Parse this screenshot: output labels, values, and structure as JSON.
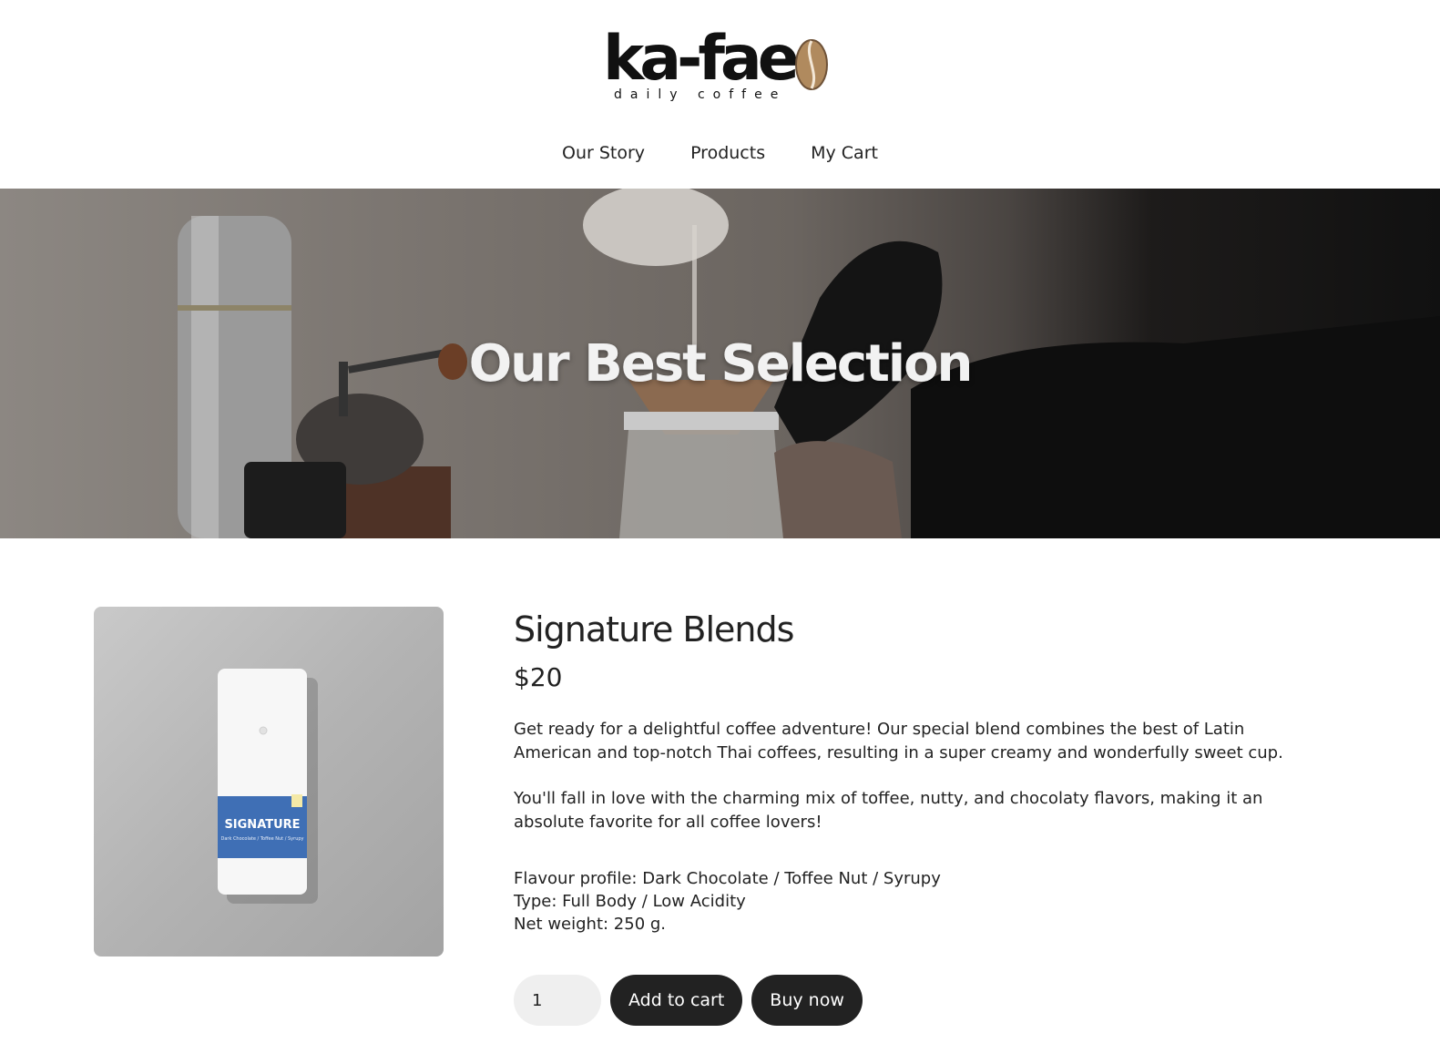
{
  "brand": {
    "name": "ka-fae",
    "tagline": "daily coffee"
  },
  "nav": {
    "items": [
      "Our Story",
      "Products",
      "My Cart"
    ]
  },
  "hero": {
    "title": "Our Best Selection"
  },
  "product": {
    "title": "Signature Blends",
    "price": "$20",
    "description": [
      "Get ready for a delightful coffee adventure! Our special blend combines the best of Latin American and top-notch Thai coffees, resulting in a super creamy and wonderfully sweet cup.",
      "You'll fall in love with the charming mix of toffee, nutty, and chocolaty flavors, making it an absolute favorite for all coffee lovers!"
    ],
    "specs": [
      "Flavour profile: Dark Chocolate / Toffee Nut / Syrupy",
      "Type: Full Body / Low Acidity",
      "Net weight: 250 g."
    ],
    "bag_label": "SIGNATURE",
    "bag_sublabel": "Dark Chocolate / Toffee Nut / Syrupy",
    "bag_label_color": "#3f6fb5"
  },
  "cart": {
    "quantity": "1",
    "add_to_cart_label": "Add to cart",
    "buy_now_label": "Buy now"
  }
}
